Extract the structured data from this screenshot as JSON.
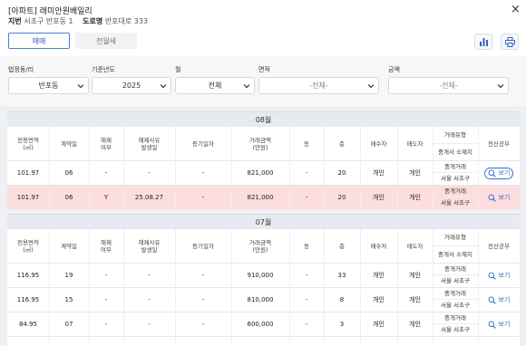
{
  "header": {
    "title": "[아파트] 래미안원베일리",
    "jibun_label": "지번",
    "jibun_value": "서초구 반포동 1",
    "road_label": "도로명",
    "road_value": "반포대로 333",
    "close": "×"
  },
  "tabs": [
    {
      "label": "매매",
      "active": true
    },
    {
      "label": "전월세",
      "active": false
    }
  ],
  "filters": {
    "dong_label": "법정동/리",
    "dong_value": "반포동",
    "year_label": "기준년도",
    "year_value": "2025",
    "month_label": "월",
    "month_value": "전체",
    "area_label": "면적",
    "area_value": "-전체-",
    "amount_label": "금액",
    "amount_value": "-전체-"
  },
  "table_headers": {
    "area": "전용면적\n(㎡)",
    "contract_day": "계약일",
    "cancel": "해제\n여부",
    "cancel_date": "해제사유\n발생일",
    "reg_date": "등기일자",
    "price": "거래금액\n(만원)",
    "dong": "동",
    "floor": "층",
    "buyer": "매수자",
    "seller": "매도자",
    "deal_type": "거래유형",
    "broker_loc": "중개사 소재지",
    "doc": "전산공부"
  },
  "groups": [
    {
      "month": "08월",
      "rows": [
        {
          "area": "101.97",
          "day": "06",
          "cancel": "-",
          "cancel_date": "-",
          "reg": "-",
          "price": "821,000",
          "dong": "-",
          "floor": "20",
          "buyer": "개인",
          "seller": "개인",
          "deal": "중개거래",
          "loc": "서울 서초구",
          "view": "보기",
          "highlight": false,
          "boxed": true
        },
        {
          "area": "101.97",
          "day": "06",
          "cancel": "Y",
          "cancel_date": "25.08.27",
          "reg": "-",
          "price": "821,000",
          "dong": "-",
          "floor": "20",
          "buyer": "개인",
          "seller": "개인",
          "deal": "중개거래",
          "loc": "서울 서초구",
          "view": "보기",
          "highlight": true,
          "boxed": false
        }
      ]
    },
    {
      "month": "07월",
      "rows": [
        {
          "area": "116.95",
          "day": "19",
          "cancel": "-",
          "cancel_date": "-",
          "reg": "-",
          "price": "910,000",
          "dong": "-",
          "floor": "33",
          "buyer": "개인",
          "seller": "개인",
          "deal": "중개거래",
          "loc": "서울 서초구",
          "view": "보기",
          "highlight": false,
          "boxed": false
        },
        {
          "area": "116.95",
          "day": "15",
          "cancel": "-",
          "cancel_date": "-",
          "reg": "-",
          "price": "810,000",
          "dong": "-",
          "floor": "8",
          "buyer": "개인",
          "seller": "개인",
          "deal": "중개거래",
          "loc": "서울 서초구",
          "view": "보기",
          "highlight": false,
          "boxed": false
        },
        {
          "area": "84.95",
          "day": "07",
          "cancel": "-",
          "cancel_date": "-",
          "reg": "-",
          "price": "600,000",
          "dong": "-",
          "floor": "3",
          "buyer": "개인",
          "seller": "개인",
          "deal": "중개거래",
          "loc": "서울 서초구",
          "view": "보기",
          "highlight": false,
          "boxed": false
        },
        {
          "area": "",
          "day": "",
          "cancel": "",
          "cancel_date": "",
          "reg": "",
          "price": "",
          "dong": "",
          "floor": "",
          "buyer": "",
          "seller": "",
          "deal": "",
          "loc": "",
          "view": "",
          "highlight": false,
          "boxed": false
        }
      ]
    }
  ],
  "icons": {
    "chart": "bar-chart-icon",
    "print": "print-icon",
    "search": "search-icon",
    "chevron": "chevron-down-icon"
  },
  "colors": {
    "accent": "#2f63c4",
    "highlight_row": "#fddede",
    "month_bar": "#e6ebf1"
  }
}
